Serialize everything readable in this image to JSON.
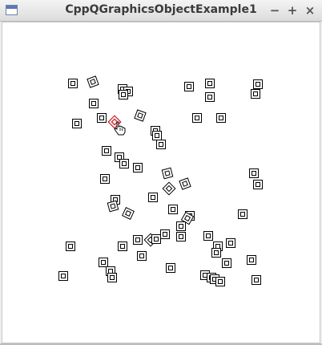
{
  "window": {
    "title": "CppQGraphicsObjectExample1",
    "minimize_label": "−",
    "maximize_label": "+",
    "close_label": "×"
  },
  "scene": {
    "item_count": 67,
    "selected_item_color": "#c00000",
    "item_color": "#000000",
    "background_color": "#ffffff"
  }
}
